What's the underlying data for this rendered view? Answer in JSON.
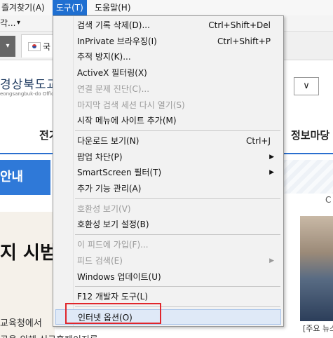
{
  "menubar": {
    "items": [
      {
        "label": "즐겨찾기(A)"
      },
      {
        "label": "도구(T)"
      },
      {
        "label": "도움말(H)"
      }
    ]
  },
  "addressbar": {
    "text": "각...",
    "dropdown": "▾"
  },
  "tab": {
    "label": "국"
  },
  "site": {
    "logo_kr": "경상북도교",
    "logo_en": "eongsangbuk-do Office",
    "nav_left": "전기",
    "nav_right": "정보마당",
    "banner": "안내",
    "headline": "지 시범",
    "para1": "교육청에서",
    "para2": "공을 위해 신규홈페이지를",
    "news_caption": "[주요 뉴스",
    "right_letter": "C"
  },
  "tools_menu": {
    "groups": [
      [
        {
          "label": "검색 기록 삭제(D)...",
          "shortcut": "Ctrl+Shift+Del",
          "disabled": false
        },
        {
          "label": "InPrivate 브라우징(I)",
          "shortcut": "Ctrl+Shift+P",
          "disabled": false
        },
        {
          "label": "추적 방지(K)...",
          "shortcut": "",
          "disabled": false
        },
        {
          "label": "ActiveX 필터링(X)",
          "shortcut": "",
          "disabled": false
        },
        {
          "label": "연결 문제 진단(C)...",
          "shortcut": "",
          "disabled": true
        },
        {
          "label": "마지막 검색 세션 다시 열기(S)",
          "shortcut": "",
          "disabled": true
        },
        {
          "label": "시작 메뉴에 사이트 추가(M)",
          "shortcut": "",
          "disabled": false
        }
      ],
      [
        {
          "label": "다운로드 보기(N)",
          "shortcut": "Ctrl+J",
          "disabled": false
        },
        {
          "label": "팝업 차단(P)",
          "submenu": true,
          "disabled": false
        },
        {
          "label": "SmartScreen 필터(T)",
          "submenu": true,
          "disabled": false
        },
        {
          "label": "추가 기능 관리(A)",
          "shortcut": "",
          "disabled": false
        }
      ],
      [
        {
          "label": "호환성 보기(V)",
          "shortcut": "",
          "disabled": true
        },
        {
          "label": "호환성 보기 설정(B)",
          "shortcut": "",
          "disabled": false
        }
      ],
      [
        {
          "label": "이 피드에 가입(F)...",
          "shortcut": "",
          "disabled": true
        },
        {
          "label": "피드 검색(E)",
          "submenu": true,
          "disabled": true
        },
        {
          "label": "Windows 업데이트(U)",
          "shortcut": "",
          "disabled": false
        }
      ],
      [
        {
          "label": "F12 개발자 도구(L)",
          "shortcut": "",
          "disabled": false
        }
      ],
      [
        {
          "label": "인터넷 옵션(O)",
          "shortcut": "",
          "disabled": false,
          "highlighted": true
        }
      ]
    ]
  },
  "colors": {
    "menu_active": "#1f6fd1",
    "highlight_box": "#e0262c",
    "banner": "#2f79d8"
  }
}
